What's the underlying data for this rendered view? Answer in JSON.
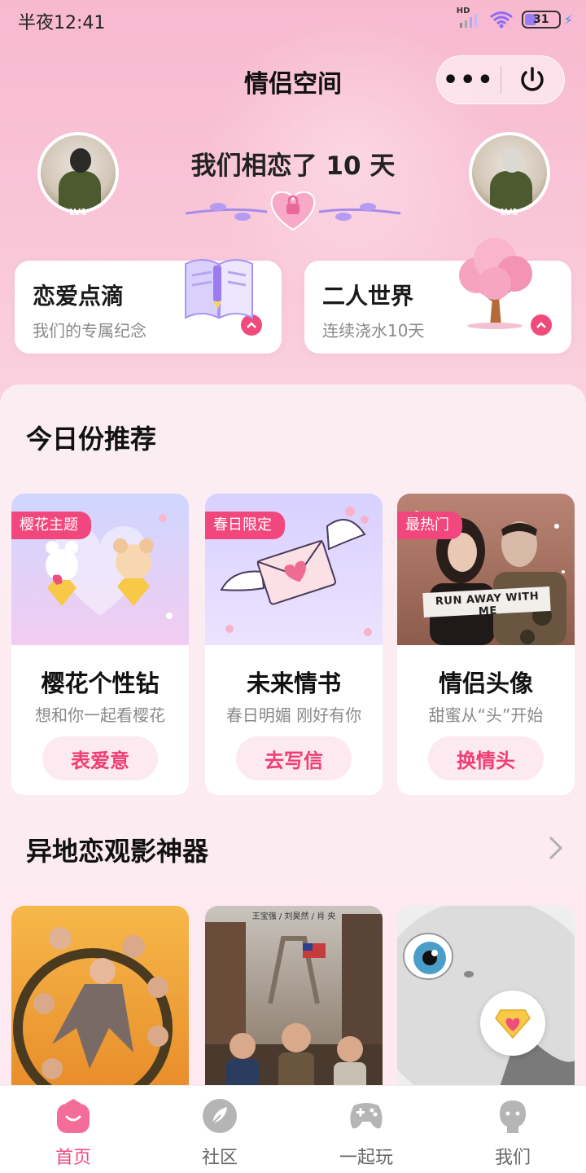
{
  "status_bar": {
    "time": "半夜12:41",
    "network": "HD",
    "battery": "31"
  },
  "header": {
    "title": "情侣空间",
    "more_icon": "more-dots-icon",
    "power_icon": "power-icon"
  },
  "couple": {
    "days_text": "我们相恋了 10 天",
    "left_level": "LV1",
    "right_level": "LV1"
  },
  "features": [
    {
      "title": "恋爱点滴",
      "subtitle": "我们的专属纪念",
      "icon": "notebook-icon"
    },
    {
      "title": "二人世界",
      "subtitle": "连续浇水10天",
      "icon": "cherry-tree-icon"
    }
  ],
  "recommend": {
    "title": "今日份推荐",
    "cards": [
      {
        "tag": "樱花主题",
        "title": "樱花个性钻",
        "subtitle": "想和你一起看樱花",
        "button": "表爱意"
      },
      {
        "tag": "春日限定",
        "title": "未来情书",
        "subtitle": "春日明媚 刚好有你",
        "button": "去写信"
      },
      {
        "tag": "最热门",
        "title": "情侣头像",
        "subtitle": "甜蜜从“头”开始",
        "button": "换情头",
        "image_text": "RUN AWAY WITH ME"
      }
    ]
  },
  "movies": {
    "title": "异地恋观影神器",
    "poster2_caption": "王宝强 / 刘昊然 / 肖 央"
  },
  "tabbar": {
    "items": [
      {
        "label": "首页",
        "active": true
      },
      {
        "label": "社区",
        "active": false
      },
      {
        "label": "一起玩",
        "active": false
      },
      {
        "label": "我们",
        "active": false
      }
    ]
  },
  "colors": {
    "accent": "#f04a7c",
    "tag": "#f2477e",
    "button_bg": "#fdeaf0"
  }
}
